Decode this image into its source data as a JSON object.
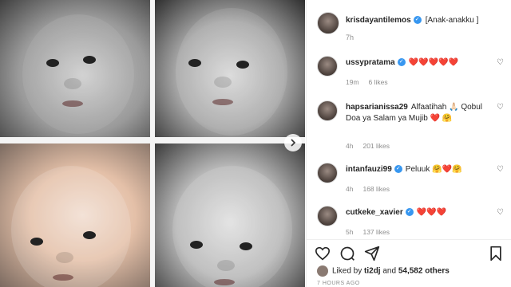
{
  "post": {
    "author": "krisdayantilemos",
    "caption": "[Anak-anakku ]",
    "time": "7h"
  },
  "comments": [
    {
      "user": "ussypratama",
      "verified": true,
      "text": "❤️❤️❤️❤️❤️",
      "time": "19m",
      "likes": "6 likes"
    },
    {
      "user": "hapsarianissa29",
      "verified": false,
      "text": "Alfaatihah 🙏🏻 Qobul Doa ya Salam ya Mujib ❤️ 🤗",
      "time": "4h",
      "likes": "201 likes"
    },
    {
      "user": "intanfauzi99",
      "verified": true,
      "text": "Peluuk 🤗❤️🤗",
      "time": "4h",
      "likes": "168 likes"
    },
    {
      "user": "cutkeke_xavier",
      "verified": true,
      "text": "❤️❤️❤️",
      "time": "5h",
      "likes": "137 likes"
    }
  ],
  "likes": {
    "prefix": "Liked by",
    "user": "ti2dj",
    "connector": "and",
    "count": "54,582 others"
  },
  "footer": {
    "timestamp": "7 HOURS AGO"
  },
  "icons": {
    "heart": "heart-icon",
    "comment": "comment-icon",
    "share": "share-icon",
    "bookmark": "bookmark-icon",
    "next": "chevron-right-icon"
  },
  "colors": {
    "verified": "#3897f0",
    "heart_red": "#ed4956",
    "muted": "#8e8e8e"
  }
}
